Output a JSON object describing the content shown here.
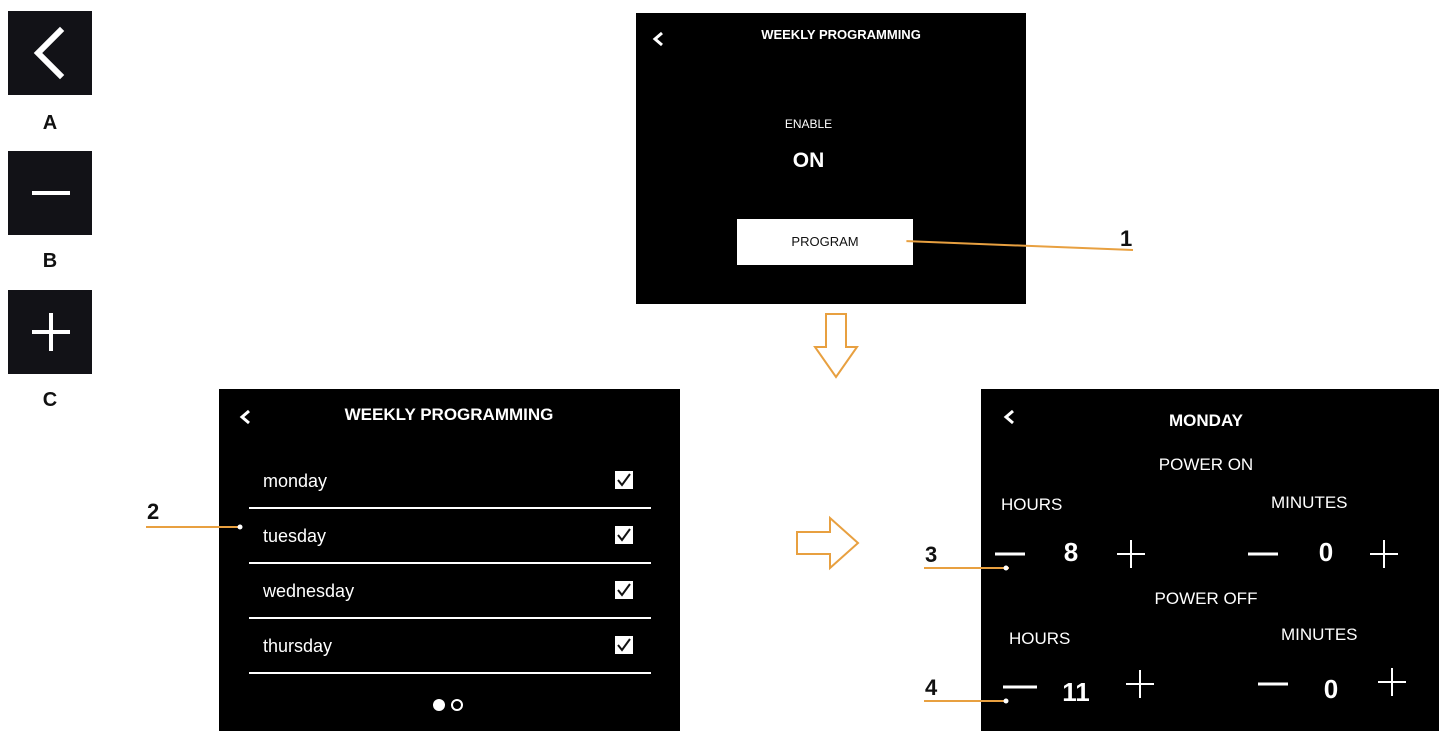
{
  "legend": [
    {
      "letter": "A",
      "icon": "back-chevron-icon"
    },
    {
      "letter": "B",
      "icon": "minus-icon"
    },
    {
      "letter": "C",
      "icon": "plus-icon"
    }
  ],
  "screen1": {
    "title": "WEEKLY PROGRAMMING",
    "enable_label": "ENABLE",
    "enable_value": "ON",
    "program_button": "PROGRAM"
  },
  "screen2": {
    "title": "WEEKLY PROGRAMMING",
    "days": [
      {
        "label": "monday",
        "checked": true
      },
      {
        "label": "tuesday",
        "checked": true
      },
      {
        "label": "wednesday",
        "checked": true
      },
      {
        "label": "thursday",
        "checked": true
      }
    ],
    "page_count": 2,
    "current_page": 1
  },
  "screen3": {
    "title": "MONDAY",
    "power_on_label": "POWER ON",
    "power_off_label": "POWER OFF",
    "hours_label": "HOURS",
    "minutes_label": "MINUTES",
    "power_on_hours": "8",
    "power_on_minutes": "0",
    "power_off_hours": "11",
    "power_off_minutes": "0"
  },
  "callouts": [
    "1",
    "2",
    "3",
    "4"
  ],
  "colors": {
    "screen_bg": "#000000",
    "legend_bg": "#121217",
    "accent_orange": "#e8a040",
    "text_light": "#ffffff"
  }
}
